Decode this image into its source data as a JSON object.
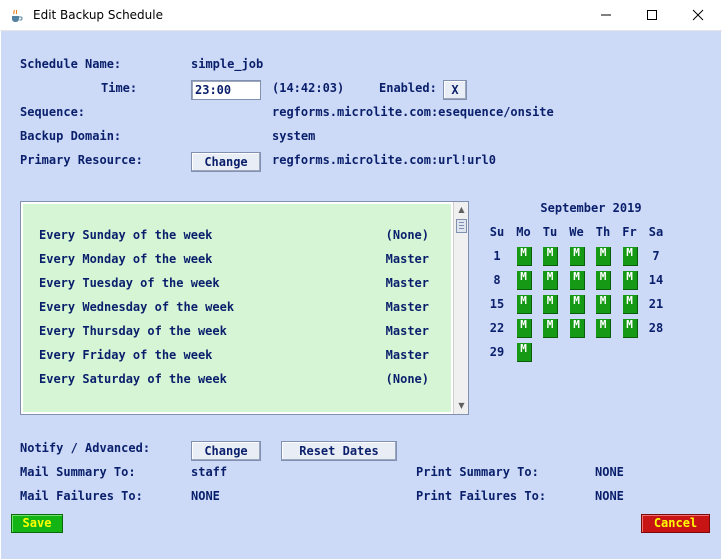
{
  "window": {
    "title": "Edit Backup Schedule",
    "app_icon": "java-cup-icon",
    "controls": [
      "minimize-icon",
      "maximize-icon",
      "close-icon"
    ]
  },
  "form": {
    "schedule_name_label": "Schedule Name:",
    "schedule_name": "simple_job",
    "time_label": "Time:",
    "time_value": "23:00",
    "current_time": "(14:42:03)",
    "enabled_label": "Enabled:",
    "enabled_value": "X",
    "sequence_label": "Sequence:",
    "sequence_value": "regforms.microlite.com:esequence/onsite",
    "domain_label": "Backup Domain:",
    "domain_value": "system",
    "resource_label": "Primary Resource:",
    "resource_button": "Change",
    "resource_value": "regforms.microlite.com:url!url0"
  },
  "schedule_list": [
    {
      "label": "Every Sunday of the week",
      "status": "(None)"
    },
    {
      "label": "Every Monday of the week",
      "status": "Master"
    },
    {
      "label": "Every Tuesday of the week",
      "status": "Master"
    },
    {
      "label": "Every Wednesday of the week",
      "status": "Master"
    },
    {
      "label": "Every Thursday of the week",
      "status": "Master"
    },
    {
      "label": "Every Friday of the week",
      "status": "Master"
    },
    {
      "label": "Every Saturday of the week",
      "status": "(None)"
    }
  ],
  "calendar": {
    "title": "September 2019",
    "weekdays": [
      "Su",
      "Mo",
      "Tu",
      "We",
      "Th",
      "Fr",
      "Sa"
    ],
    "mark_label": "M",
    "mark_color": "#169a16",
    "weeks": [
      [
        "1",
        "M",
        "M",
        "M",
        "M",
        "M",
        "7"
      ],
      [
        "8",
        "M",
        "M",
        "M",
        "M",
        "M",
        "14"
      ],
      [
        "15",
        "M",
        "M",
        "M",
        "M",
        "M",
        "21"
      ],
      [
        "22",
        "M",
        "M",
        "M",
        "M",
        "M",
        "28"
      ],
      [
        "29",
        "M",
        "",
        "",
        "",
        "",
        ""
      ]
    ]
  },
  "notify": {
    "label": "Notify / Advanced:",
    "change_button": "Change",
    "reset_button": "Reset Dates",
    "mail_summary_label": "Mail Summary To:",
    "mail_summary_value": "staff",
    "print_summary_label": "Print Summary To:",
    "print_summary_value": "NONE",
    "mail_failures_label": "Mail Failures To:",
    "mail_failures_value": "NONE",
    "print_failures_label": "Print Failures To:",
    "print_failures_value": "NONE"
  },
  "actions": {
    "save": "Save",
    "cancel": "Cancel",
    "save_color": "#15b415",
    "cancel_color": "#c81414"
  }
}
